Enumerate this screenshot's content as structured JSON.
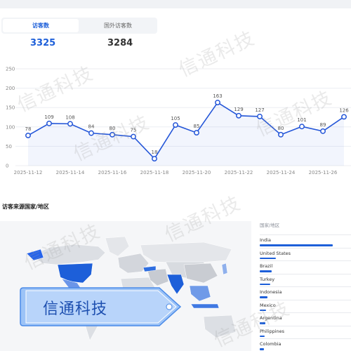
{
  "tabs": {
    "domestic_label": "访客数",
    "foreign_label": "国外访客数"
  },
  "stats": {
    "domestic_value": "3325",
    "foreign_value": "3284"
  },
  "chart_data": {
    "type": "line",
    "x": [
      "2025-11-12",
      "2025-11-13",
      "2025-11-14",
      "2025-11-15",
      "2025-11-16",
      "2025-11-17",
      "2025-11-18",
      "2025-11-19",
      "2025-11-20",
      "2025-11-21",
      "2025-11-22",
      "2025-11-23",
      "2025-11-24",
      "2025-11-25",
      "2025-11-26",
      "2025-11-27"
    ],
    "values": [
      78,
      109,
      108,
      84,
      80,
      75,
      18,
      105,
      85,
      163,
      129,
      127,
      80,
      101,
      89,
      126
    ],
    "x_tick_labels": [
      "2025-11-12",
      "2025-11-14",
      "2025-11-16",
      "2025-11-18",
      "2025-11-20",
      "2025-11-22",
      "2025-11-24",
      "2025-11-26"
    ],
    "y_ticks": [
      0,
      50,
      100,
      150,
      200,
      250
    ],
    "ylim": [
      0,
      250
    ],
    "grid": true,
    "color": "#2456d8"
  },
  "map_section": {
    "title": "访客来源国家/地区",
    "list_header": "国家/地区",
    "countries": [
      {
        "name": "India",
        "share": 1.0
      },
      {
        "name": "United States",
        "share": 0.22
      },
      {
        "name": "Brazil",
        "share": 0.16
      },
      {
        "name": "Turkey",
        "share": 0.14
      },
      {
        "name": "Indonesia",
        "share": 0.11
      },
      {
        "name": "Mexico",
        "share": 0.09
      },
      {
        "name": "Argentina",
        "share": 0.08
      },
      {
        "name": "Philippines",
        "share": 0.07
      },
      {
        "name": "Colombia",
        "share": 0.06
      }
    ]
  },
  "badge": {
    "text": "信通科技"
  },
  "watermark": {
    "text": "信通科技"
  }
}
